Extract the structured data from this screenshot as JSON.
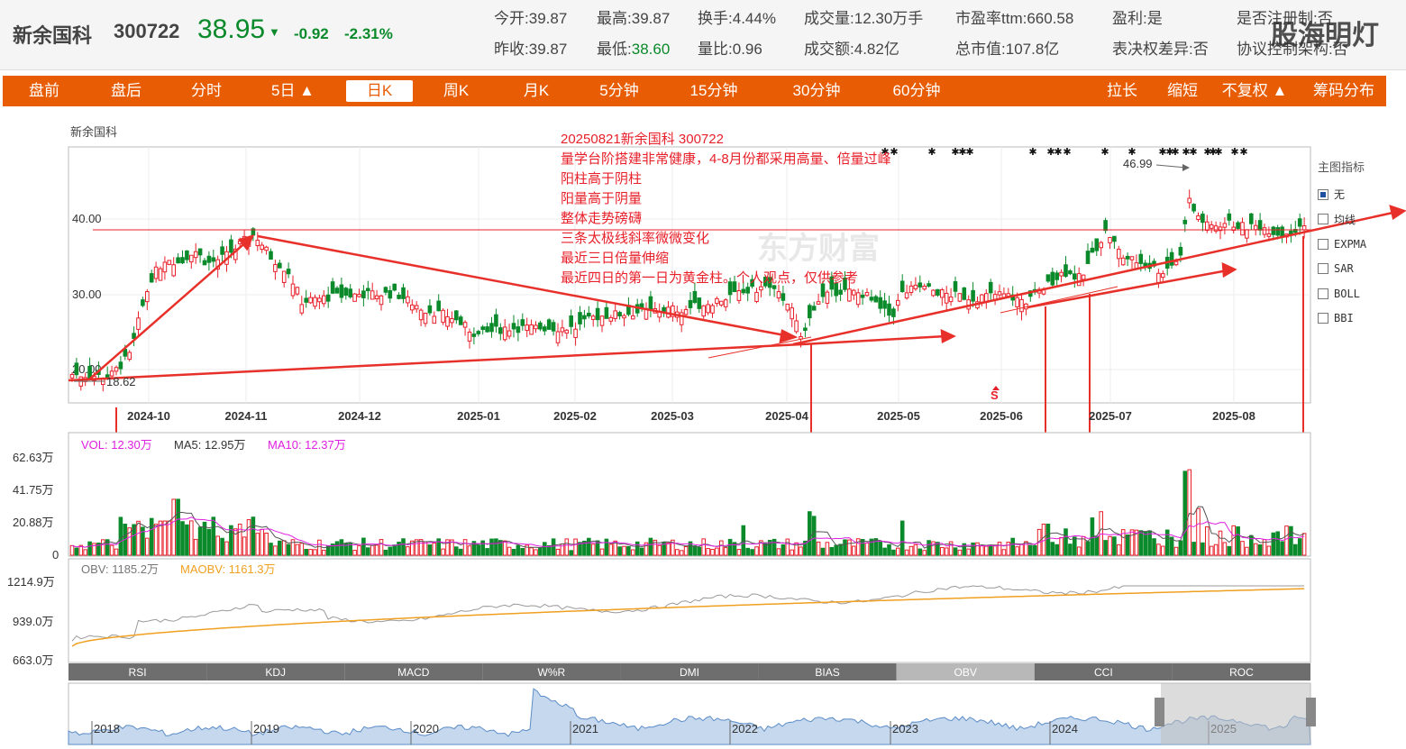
{
  "header": {
    "name": "新余国科",
    "code": "300722",
    "price": "38.95",
    "arrow": "▼",
    "change": "-0.92",
    "change_pct": "-2.31%",
    "quote_row1": [
      {
        "label": "今开:",
        "value": "39.87"
      },
      {
        "label": "最高:",
        "value": "39.87"
      },
      {
        "label": "换手:",
        "value": "4.44%"
      },
      {
        "label": "成交量:",
        "value": "12.30万手"
      },
      {
        "label": "市盈率ttm:",
        "value": "660.58"
      },
      {
        "label": "盈利:",
        "value": "是"
      },
      {
        "label": "是否注册制:",
        "value": "否"
      }
    ],
    "quote_row2": [
      {
        "label": "昨收:",
        "value": "39.87"
      },
      {
        "label": "最低:",
        "value": "38.60"
      },
      {
        "label": "量比:",
        "value": "0.96"
      },
      {
        "label": "成交额:",
        "value": "4.82亿"
      },
      {
        "label": "总市值:",
        "value": "107.8亿"
      },
      {
        "label": "表决权差异:",
        "value": "否"
      },
      {
        "label": "协议控制架构:",
        "value": "否"
      }
    ],
    "watermark": "股海明灯"
  },
  "tabs": [
    "盘前",
    "盘后",
    "分时",
    "5日 ▲",
    "日K",
    "周K",
    "月K",
    "5分钟",
    "15分钟",
    "30分钟",
    "60分钟"
  ],
  "right_tabs": [
    "拉长",
    "缩短",
    "不复权 ▲",
    "筹码分布"
  ],
  "active_tab": "日K",
  "indicator_panel": {
    "title": "主图指标",
    "items": [
      "无",
      "均线",
      "EXPMA",
      "SAR",
      "BOLL",
      "BBI"
    ],
    "selected": "无"
  },
  "main_chart": {
    "stock_label": "新余国科",
    "y_ticks": [
      "40.00",
      "30.00",
      "20.00"
    ],
    "x_ticks": [
      "2024-10",
      "2024-11",
      "2024-12",
      "2025-01",
      "2025-02",
      "2025-03",
      "2025-04",
      "2025-05",
      "2025-06",
      "2025-07",
      "2025-08"
    ],
    "high_label": "46.99",
    "low_label": "18.62",
    "s_marker": "S",
    "annotation": [
      "20250821新余国科 300722",
      "量学台阶搭建非常健康，4-8月份都采用高量、倍量过峰",
      "阳柱高于阴柱",
      "阳量高于阴量",
      "整体走势磅礴",
      "三条太极线斜率微微变化",
      "最近三日倍量伸缩",
      "最近四日的第一日为黄金柱。个人观点，仅供参考"
    ],
    "bg_watermark": "东方财富"
  },
  "volume_chart": {
    "vol_label": "VOL: 12.30万",
    "ma5_label": "MA5: 12.95万",
    "ma10_label": "MA10: 12.37万",
    "y_ticks": [
      "62.63万",
      "41.75万",
      "20.88万",
      "0"
    ]
  },
  "obv_chart": {
    "obv_label": "OBV: 1185.2万",
    "maobv_label": "MAOBV: 1161.3万",
    "y_ticks": [
      "1214.9万",
      "939.0万",
      "663.0万"
    ]
  },
  "indicator_tabs": [
    "RSI",
    "KDJ",
    "MACD",
    "W%R",
    "DMI",
    "BIAS",
    "OBV",
    "CCI",
    "ROC"
  ],
  "active_indicator": "OBV",
  "navigator": {
    "years": [
      "2018",
      "2019",
      "2020",
      "2021",
      "2022",
      "2023",
      "2024",
      "2025"
    ]
  },
  "colors": {
    "up": "#e8202a",
    "down": "#0a8a2a",
    "accent": "#e85d04",
    "ma5": "#555555",
    "ma10": "#e020e0",
    "maobv": "#f0a020"
  }
}
